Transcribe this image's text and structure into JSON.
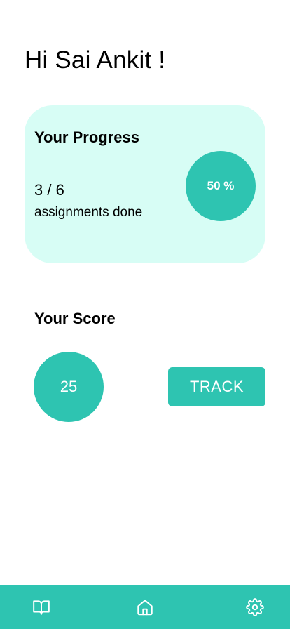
{
  "greeting": "Hi Sai Ankit !",
  "progress": {
    "title": "Your Progress",
    "count": "3 / 6",
    "caption": "assignments done",
    "percent_label": "50 %",
    "completed": 3,
    "total": 6
  },
  "score": {
    "title": "Your Score",
    "value": "25",
    "track_label": "TRACK"
  },
  "bottom_nav": {
    "items": [
      {
        "icon": "book-icon"
      },
      {
        "icon": "home-icon"
      },
      {
        "icon": "gear-icon"
      }
    ]
  },
  "colors": {
    "accent": "#2ec4b1",
    "card_bg": "#d7fdf5",
    "background": "#ffffff",
    "text": "#000000",
    "icon": "#ffffff"
  }
}
